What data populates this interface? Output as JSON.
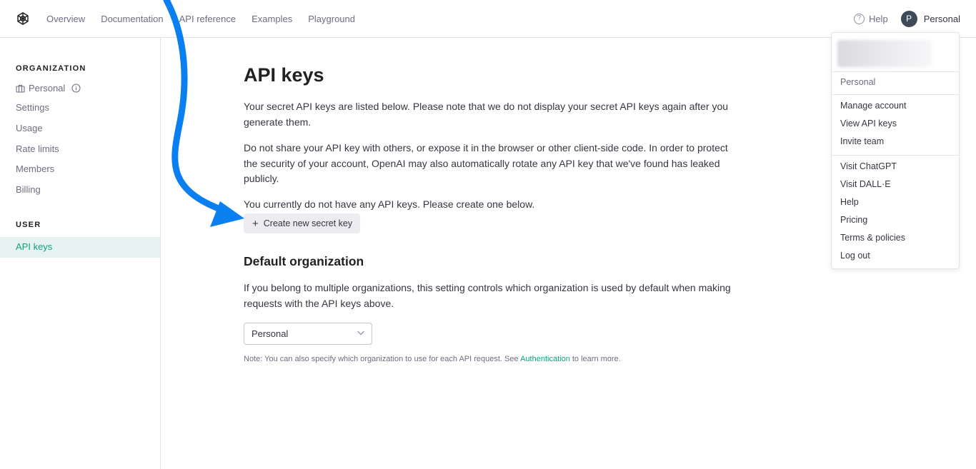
{
  "nav": {
    "items": [
      "Overview",
      "Documentation",
      "API reference",
      "Examples",
      "Playground"
    ],
    "help_label": "Help",
    "help_symbol": "?",
    "account_initial": "P",
    "account_name": "Personal"
  },
  "sidebar": {
    "org_heading": "ORGANIZATION",
    "org_name": "Personal",
    "org_items": [
      "Settings",
      "Usage",
      "Rate limits",
      "Members",
      "Billing"
    ],
    "user_heading": "USER",
    "active_item": "API keys"
  },
  "main": {
    "title": "API keys",
    "para1": "Your secret API keys are listed below. Please note that we do not display your secret API keys again after you generate them.",
    "para2": "Do not share your API key with others, or expose it in the browser or other client-side code. In order to protect the security of your account, OpenAI may also automatically rotate any API key that we've found has leaked publicly.",
    "para3": "You currently do not have any API keys. Please create one below.",
    "create_button": "Create new secret key",
    "default_org_title": "Default organization",
    "default_org_text": "If you belong to multiple organizations, this setting controls which organization is used by default when making requests with the API keys above.",
    "org_select_value": "Personal",
    "note_prefix": "Note: You can also specify which organization to use for each API request. See ",
    "note_link": "Authentication",
    "note_suffix": " to learn more."
  },
  "dropdown": {
    "org_label": "Personal",
    "account_items": [
      "Manage account",
      "View API keys",
      "Invite team"
    ],
    "link_items": [
      "Visit ChatGPT",
      "Visit DALL·E",
      "Help",
      "Pricing",
      "Terms & policies",
      "Log out"
    ]
  },
  "colors": {
    "accent": "#10a37f",
    "annotation_arrow": "#0a7ff0",
    "active_bg": "#e6f3f0"
  }
}
